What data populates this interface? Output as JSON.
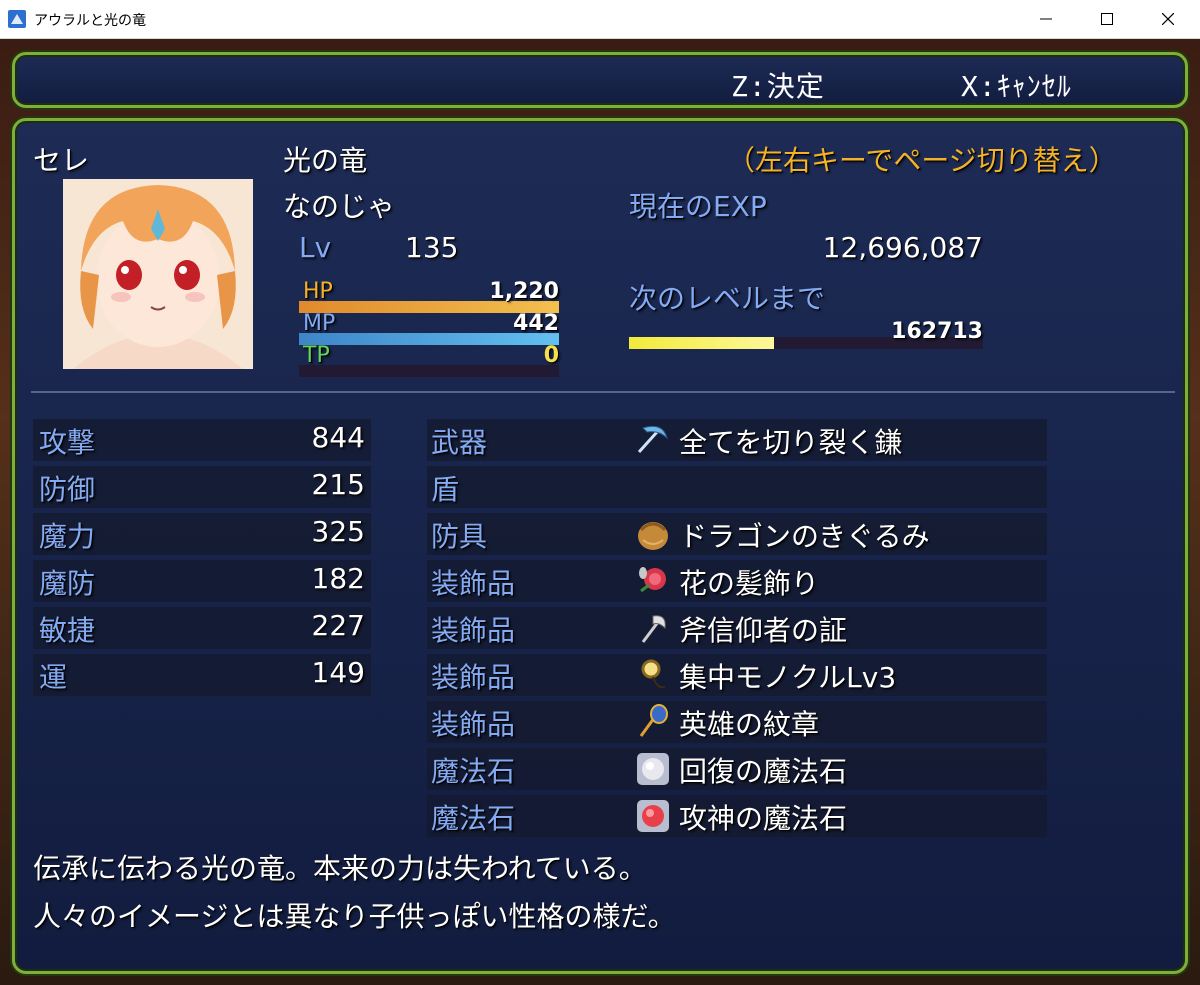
{
  "window": {
    "title": "アウラルと光の竜"
  },
  "help": {
    "confirm": "Z:決定",
    "cancel": "X:ｷｬﾝｾﾙ"
  },
  "actor": {
    "name": "セレ",
    "class": "光の竜",
    "nickname": "なのじゃ",
    "level_label": "Lv",
    "level": "135",
    "hp_label": "HP",
    "hp": "1,220",
    "mp_label": "MP",
    "mp": "442",
    "tp_label": "TP",
    "tp": "0",
    "hp_ratio": 1.0,
    "mp_ratio": 1.0,
    "tp_ratio": 0.0
  },
  "exp": {
    "page_hint": "（左右キーでページ切り替え）",
    "current_label": "現在のEXP",
    "current": "12,696,087",
    "next_label": "次のレベルまで",
    "next": "162713",
    "progress_ratio": 0.41
  },
  "params": [
    {
      "label": "攻撃",
      "value": "844"
    },
    {
      "label": "防御",
      "value": "215"
    },
    {
      "label": "魔力",
      "value": "325"
    },
    {
      "label": "魔防",
      "value": "182"
    },
    {
      "label": "敏捷",
      "value": "227"
    },
    {
      "label": "運",
      "value": "149"
    }
  ],
  "equips": [
    {
      "slot": "武器",
      "item": "全てを切り裂く鎌",
      "icon": "scythe-icon"
    },
    {
      "slot": "盾",
      "item": "",
      "icon": ""
    },
    {
      "slot": "防具",
      "item": "ドラゴンのきぐるみ",
      "icon": "fur-costume-icon"
    },
    {
      "slot": "装飾品",
      "item": "花の髪飾り",
      "icon": "rose-icon"
    },
    {
      "slot": "装飾品",
      "item": "斧信仰者の証",
      "icon": "axe-icon"
    },
    {
      "slot": "装飾品",
      "item": "集中モノクルLv3",
      "icon": "monocle-icon"
    },
    {
      "slot": "装飾品",
      "item": "英雄の紋章",
      "icon": "emblem-icon"
    },
    {
      "slot": "魔法石",
      "item": "回復の魔法石",
      "icon": "white-orb-icon"
    },
    {
      "slot": "魔法石",
      "item": "攻神の魔法石",
      "icon": "red-orb-icon"
    }
  ],
  "description": {
    "line1": "伝承に伝わる光の竜。本来の力は失われている。",
    "line2": "人々のイメージとは異なり子供っぽい性格の様だ。"
  },
  "colors": {
    "system": "#84aaf4",
    "hint": "#f3b228",
    "window_border": "#7fae3a",
    "window_bg": "#1a2550"
  }
}
